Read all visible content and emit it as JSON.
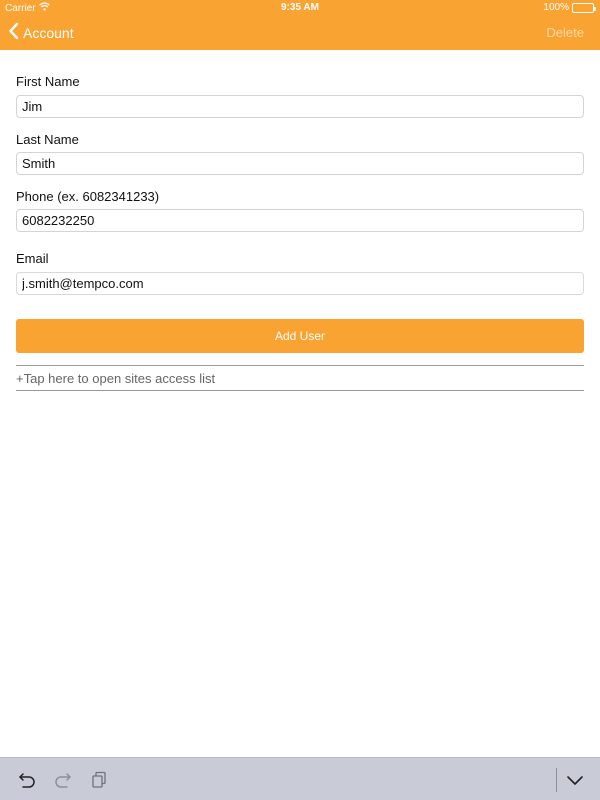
{
  "status_bar": {
    "carrier": "Carrier",
    "time": "9:35 AM",
    "battery": "100%",
    "icons": [
      "wifi-icon",
      "battery-icon"
    ]
  },
  "nav": {
    "back_label": "Account",
    "delete_label": "Delete",
    "back_icon": "chevron-left-icon"
  },
  "form": {
    "first_name": {
      "label": "First Name",
      "value": "Jim"
    },
    "last_name": {
      "label": "Last Name",
      "value": "Smith"
    },
    "phone": {
      "label": "Phone (ex. 6082341233)",
      "value": "6082232250"
    },
    "email": {
      "label": "Email",
      "value": "j.smith@tempco.com"
    }
  },
  "actions": {
    "add_user_label": "Add User",
    "sites_access_label": "+Tap here to open sites access list"
  },
  "toolbar": {
    "icons": [
      "undo-icon",
      "redo-icon",
      "paste-icon",
      "hide-keyboard-icon"
    ]
  },
  "colors": {
    "accent": "#f9a333",
    "delete_disabled": "#ffd9a6",
    "toolbar_bg": "#c9ccd6"
  }
}
